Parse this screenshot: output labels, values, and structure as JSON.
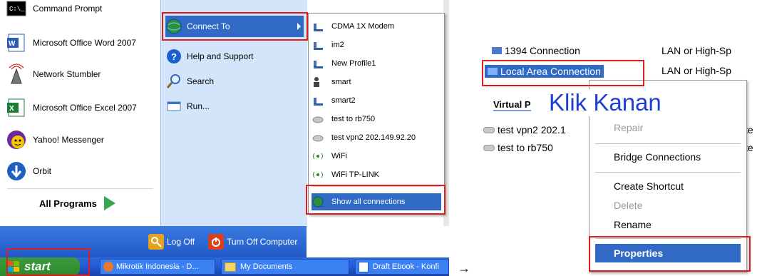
{
  "left_panel": {
    "pinned": [
      {
        "label": "Command Prompt",
        "icon": "cmd-icon"
      },
      {
        "label": "Microsoft Office Word 2007",
        "icon": "word-icon"
      },
      {
        "label": "Network Stumbler",
        "icon": "antenna-icon"
      },
      {
        "label": "Microsoft Office Excel 2007",
        "icon": "excel-icon"
      },
      {
        "label": "Yahoo! Messenger",
        "icon": "yahoo-icon"
      },
      {
        "label": "Orbit",
        "icon": "orbit-icon"
      }
    ],
    "all_programs": "All Programs"
  },
  "right_column": {
    "connect_to": "Connect To",
    "help": "Help and Support",
    "search": "Search",
    "run": "Run..."
  },
  "connect_submenu": {
    "items": [
      {
        "label": "CDMA 1X Modem",
        "icon": "dialup-icon"
      },
      {
        "label": "im2",
        "icon": "dialup-icon"
      },
      {
        "label": "New Profile1",
        "icon": "dialup-icon"
      },
      {
        "label": "smart",
        "icon": "dialup-icon"
      },
      {
        "label": "smart2",
        "icon": "dialup-icon"
      },
      {
        "label": "test to rb750",
        "icon": "vpn-icon"
      },
      {
        "label": "test vpn2 202.149.92.20",
        "icon": "vpn-icon"
      },
      {
        "label": "WiFi",
        "icon": "wireless-icon"
      },
      {
        "label": "WiFi TP-LINK",
        "icon": "wireless-icon"
      }
    ],
    "show_all": "Show all connections"
  },
  "footer": {
    "log_off": "Log Off",
    "turn_off": "Turn Off Computer"
  },
  "taskbar": {
    "start": "start",
    "tasks": [
      "Mikrotik Indonesia - D...",
      "My Documents",
      "Draft Ebook - Konfi"
    ]
  },
  "arrow": "→",
  "network_window": {
    "conn_1394": "1394 Connection",
    "lan_type_1": "LAN or High-Sp",
    "local_area": "Local Area Connection",
    "lan_type_2": "LAN or High-Sp",
    "virtual_header": "Virtual P",
    "vpn_rows": [
      "test vpn2 202.1",
      "test to rb750"
    ],
    "vpn_status": [
      "te",
      "te"
    ]
  },
  "annotation": "Klik Kanan",
  "context_menu": {
    "repair": "Repair",
    "bridge": "Bridge Connections",
    "shortcut": "Create Shortcut",
    "delete": "Delete",
    "rename": "Rename",
    "properties": "Properties"
  },
  "colors": {
    "highlight": "#316ac5",
    "annotation_red": "#e01c1c",
    "annotation_text": "#1d3fd6"
  }
}
